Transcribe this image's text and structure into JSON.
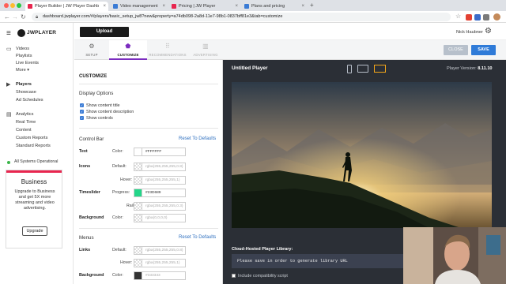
{
  "browser": {
    "tabs": [
      {
        "title": "Player Builder | JW Player Dashb",
        "active": true,
        "favicon_color": "#e8264f"
      },
      {
        "title": "Video management",
        "active": false,
        "favicon_color": "#3a7bd5"
      },
      {
        "title": "Pricing | JW Player",
        "active": false,
        "favicon_color": "#e8264f"
      },
      {
        "title": "Plans and pricing",
        "active": false,
        "favicon_color": "#3a7bd5"
      }
    ],
    "url": "dashboard.jwplayer.com/#/players/basic_setup_jw8?new&property=a74db098-2a8d-11e7-98b1-0837bff81e3&tab=customize"
  },
  "sidebar": {
    "logo_text": "JWPLAYER",
    "groups": [
      {
        "icon": "video-icon",
        "items": [
          "Videos",
          "Playlists",
          "Live Events",
          "More ▾"
        ]
      },
      {
        "icon": "play-icon",
        "items": [
          "Players",
          "Showcase",
          "Ad Schedules"
        ]
      },
      {
        "icon": "analytics-icon",
        "items": [
          "Analytics",
          "Real Time",
          "Content",
          "Custom Reports",
          "Standard Reports"
        ]
      }
    ],
    "status": "All Systems Operational",
    "upgrade": {
      "title": "Business",
      "body": "Upgrade to Business and get 5X more streaming and video advertising.",
      "button": "Upgrade"
    }
  },
  "topbar": {
    "upload_label": "Upload",
    "user_name": "Nick Haubner"
  },
  "steps": [
    {
      "label": "SETUP",
      "icon": "gear-icon",
      "state": "normal"
    },
    {
      "label": "CUSTOMIZE",
      "icon": "paint-icon",
      "state": "active"
    },
    {
      "label": "RECOMMENDATIONS",
      "icon": "grid-icon",
      "state": "dim"
    },
    {
      "label": "ADVERTISING",
      "icon": "ad-icon",
      "state": "dim"
    }
  ],
  "customize": {
    "heading": "CUSTOMIZE",
    "display_options": {
      "title": "Display Options",
      "options": [
        {
          "label": "Show content title",
          "checked": true
        },
        {
          "label": "Show content description",
          "checked": true
        },
        {
          "label": "Show controls",
          "checked": true
        }
      ]
    },
    "control_bar": {
      "title": "Control Bar",
      "reset": "Reset To Defaults",
      "rows": {
        "text_label": "Text",
        "text_color_label": "Color:",
        "text_color_value": "#FFFFFF",
        "icons_label": "Icons",
        "icons_default_label": "Default:",
        "icons_default_ph": "rgba(255,255,255,0.8)",
        "icons_hover_label": "Hover:",
        "icons_hover_ph": "rgba(255,255,255,1)",
        "timeslider_label": "Timeslider",
        "ts_progress_label": "Progress:",
        "ts_progress_value": "#23D689",
        "ts_progress_color": "#23d689",
        "ts_rail_label": "Rail:",
        "ts_rail_ph": "rgba(255,255,255,0.3)",
        "background_label": "Background",
        "bg_color_label": "Color:",
        "bg_color_ph": "rgba(0,0,0,0)"
      }
    },
    "menus": {
      "title": "Menus",
      "reset": "Reset To Defaults",
      "links_label": "Links",
      "links_default_label": "Default:",
      "links_default_ph": "rgba(255,255,255,0.8)",
      "links_hover_label": "Hover:",
      "links_hover_ph": "rgba(255,255,255,1)",
      "background_label": "Background",
      "bg_color_label": "Color:",
      "bg_color_value": "#333333",
      "bg_color_swatch": "#333333"
    }
  },
  "preview": {
    "close_label": "CLOSE",
    "save_label": "SAVE",
    "player_title": "Untitled Player",
    "version_label": "Player Version: ",
    "version_value": "8.11.10",
    "library_label": "Cloud-Hosted Player Library:",
    "library_code": "Please save in order to generate library URL",
    "compat_label": "Include compatibility script"
  }
}
